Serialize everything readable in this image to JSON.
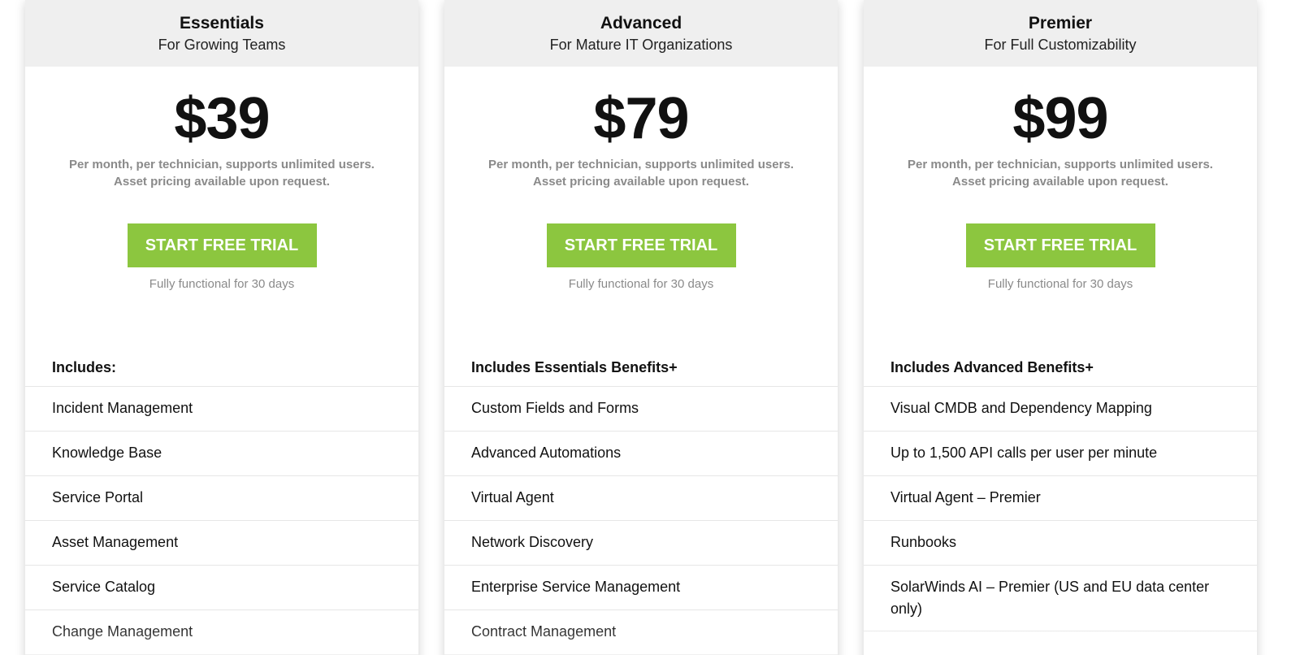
{
  "plans": [
    {
      "name": "Essentials",
      "subtitle": "For Growing Teams",
      "price": "$39",
      "price_note_1": "Per month, per technician, supports unlimited users.",
      "price_note_2": "Asset pricing available upon request.",
      "cta_label": "START FREE TRIAL",
      "trial_note": "Fully functional for 30 days",
      "features_heading": "Includes:",
      "features": [
        "Incident Management",
        "Knowledge Base",
        "Service Portal",
        "Asset Management",
        "Service Catalog",
        "Change Management"
      ]
    },
    {
      "name": "Advanced",
      "subtitle": "For Mature IT Organizations",
      "price": "$79",
      "price_note_1": "Per month, per technician, supports unlimited users.",
      "price_note_2": "Asset pricing available upon request.",
      "cta_label": "START FREE TRIAL",
      "trial_note": "Fully functional for 30 days",
      "features_heading": "Includes Essentials Benefits+",
      "features": [
        "Custom Fields and Forms",
        "Advanced Automations",
        "Virtual Agent",
        "Network Discovery",
        "Enterprise Service Management",
        "Contract Management"
      ]
    },
    {
      "name": "Premier",
      "subtitle": "For Full Customizability",
      "price": "$99",
      "price_note_1": "Per month, per technician, supports unlimited users.",
      "price_note_2": "Asset pricing available upon request.",
      "cta_label": "START FREE TRIAL",
      "trial_note": "Fully functional for 30 days",
      "features_heading": "Includes Advanced Benefits+",
      "features": [
        "Visual CMDB and Dependency Mapping",
        "Up to 1,500 API calls per user per minute",
        "Virtual Agent – Premier",
        "Runbooks",
        "SolarWinds AI – Premier (US and EU data center only)"
      ]
    }
  ],
  "colors": {
    "cta_background": "#8cc63f",
    "header_background": "#efefef",
    "muted_text": "#8a8a8a"
  }
}
